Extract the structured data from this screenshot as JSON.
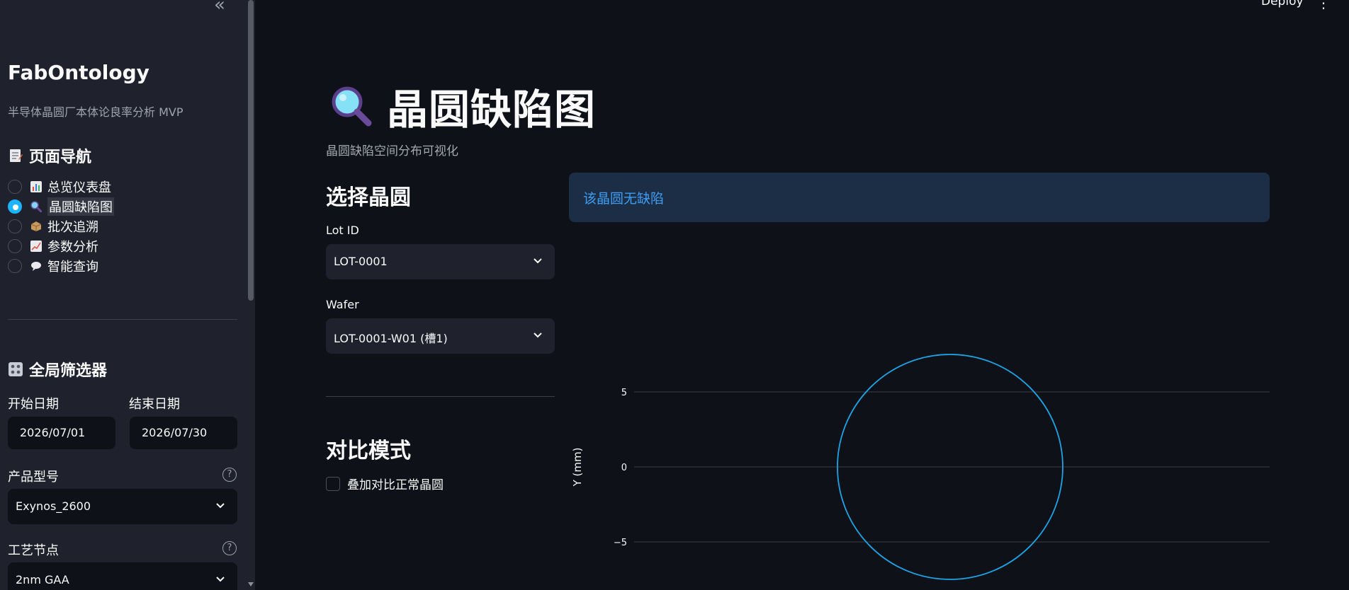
{
  "sidebar": {
    "collapse_glyph": "«",
    "app_title": "FabOntology",
    "app_subtitle": "半导体晶圆厂本体论良率分析 MVP",
    "nav_heading": "页面导航",
    "nav_items": [
      {
        "label": "总览仪表盘",
        "selected": false
      },
      {
        "label": "晶圆缺陷图",
        "selected": true
      },
      {
        "label": "批次追溯",
        "selected": false
      },
      {
        "label": "参数分析",
        "selected": false
      },
      {
        "label": "智能查询",
        "selected": false
      }
    ],
    "filters_heading": "全局筛选器",
    "start_date_label": "开始日期",
    "start_date_value": "2026/07/01",
    "end_date_label": "结束日期",
    "end_date_value": "2026/07/30",
    "product_label": "产品型号",
    "product_value": "Exynos_2600",
    "process_label": "工艺节点",
    "process_value": "2nm GAA",
    "help_glyph": "?"
  },
  "header": {
    "deploy_label": "Deploy",
    "menu_glyph": "⋮"
  },
  "main": {
    "title": "晶圆缺陷图",
    "caption": "晶圆缺陷空间分布可视化",
    "select_heading": "选择晶圆",
    "lot_label": "Lot ID",
    "lot_value": "LOT-0001",
    "wafer_label": "Wafer",
    "wafer_value": "LOT-0001-W01 (槽1)",
    "compare_heading": "对比模式",
    "overlay_label": "叠加对比正常晶圆",
    "overlay_checked": false,
    "info_message": "该晶圆无缺陷"
  },
  "colors": {
    "accent": "#1cb3ff",
    "info_text": "#3d9df3",
    "info_bg": "#1c2e46",
    "wafer_outline": "#1ca4e8"
  },
  "chart_data": {
    "type": "scatter",
    "title": "",
    "xlabel": "",
    "ylabel": "Y (mm)",
    "y_ticks": [
      5,
      0,
      -5
    ],
    "ylim": [
      -7.5,
      7.5
    ],
    "series": [],
    "wafer_outline": {
      "center": [
        0,
        0
      ],
      "radius": 7.5
    },
    "grid": true
  }
}
